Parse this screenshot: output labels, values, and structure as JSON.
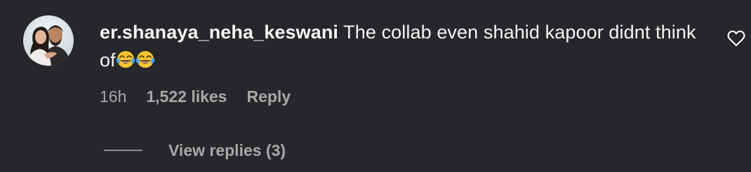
{
  "comment": {
    "username": "er.shanaya_neha_keswani",
    "text": "The collab even shahid kapoor didnt think of",
    "emojis": [
      "face-with-tears-of-joy",
      "face-with-tears-of-joy"
    ],
    "time": "16h",
    "likes": "1,522 likes",
    "reply_label": "Reply",
    "view_replies_label": "View replies (3)",
    "like_icon": "heart-outline-icon"
  },
  "colors": {
    "background": "#26272b",
    "primary_text": "#f5f5f5",
    "secondary_text": "#a8a8a8",
    "emoji_face": "#f7c531",
    "emoji_tears": "#4da3e8"
  }
}
